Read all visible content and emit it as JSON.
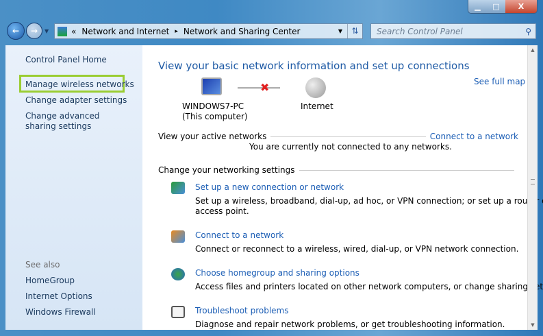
{
  "window": {
    "minimize": "▁",
    "maximize": "□",
    "close": "X"
  },
  "address": {
    "sep": "«",
    "crumbs": [
      "Network and Internet",
      "Network and Sharing Center"
    ],
    "arrow": "▸"
  },
  "search": {
    "placeholder": "Search Control Panel"
  },
  "sidebar": {
    "home": "Control Panel Home",
    "items": [
      "Manage wireless networks",
      "Change adapter settings",
      "Change advanced sharing settings"
    ],
    "see_also": "See also",
    "see_also_items": [
      "HomeGroup",
      "Internet Options",
      "Windows Firewall"
    ]
  },
  "main": {
    "title": "View your basic network information and set up connections",
    "see_full_map": "See full map",
    "computer_name": "WINDOWS7-PC",
    "computer_sub": "(This computer)",
    "internet": "Internet",
    "active_label": "View your active networks",
    "connect_link": "Connect to a network",
    "not_connected": "You are currently not connected to any networks.",
    "change_label": "Change your networking settings",
    "tasks": [
      {
        "title": "Set up a new connection or network",
        "desc": "Set up a wireless, broadband, dial-up, ad hoc, or VPN connection; or set up a router or",
        "desc2": "access point."
      },
      {
        "title": "Connect to a network",
        "desc": "Connect or reconnect to a wireless, wired, dial-up, or VPN network connection."
      },
      {
        "title": "Choose homegroup and sharing options",
        "desc": "Access files and printers located on other network computers, or change sharing settings."
      },
      {
        "title": "Troubleshoot problems",
        "desc": "Diagnose and repair network problems, or get troubleshooting information."
      }
    ]
  }
}
